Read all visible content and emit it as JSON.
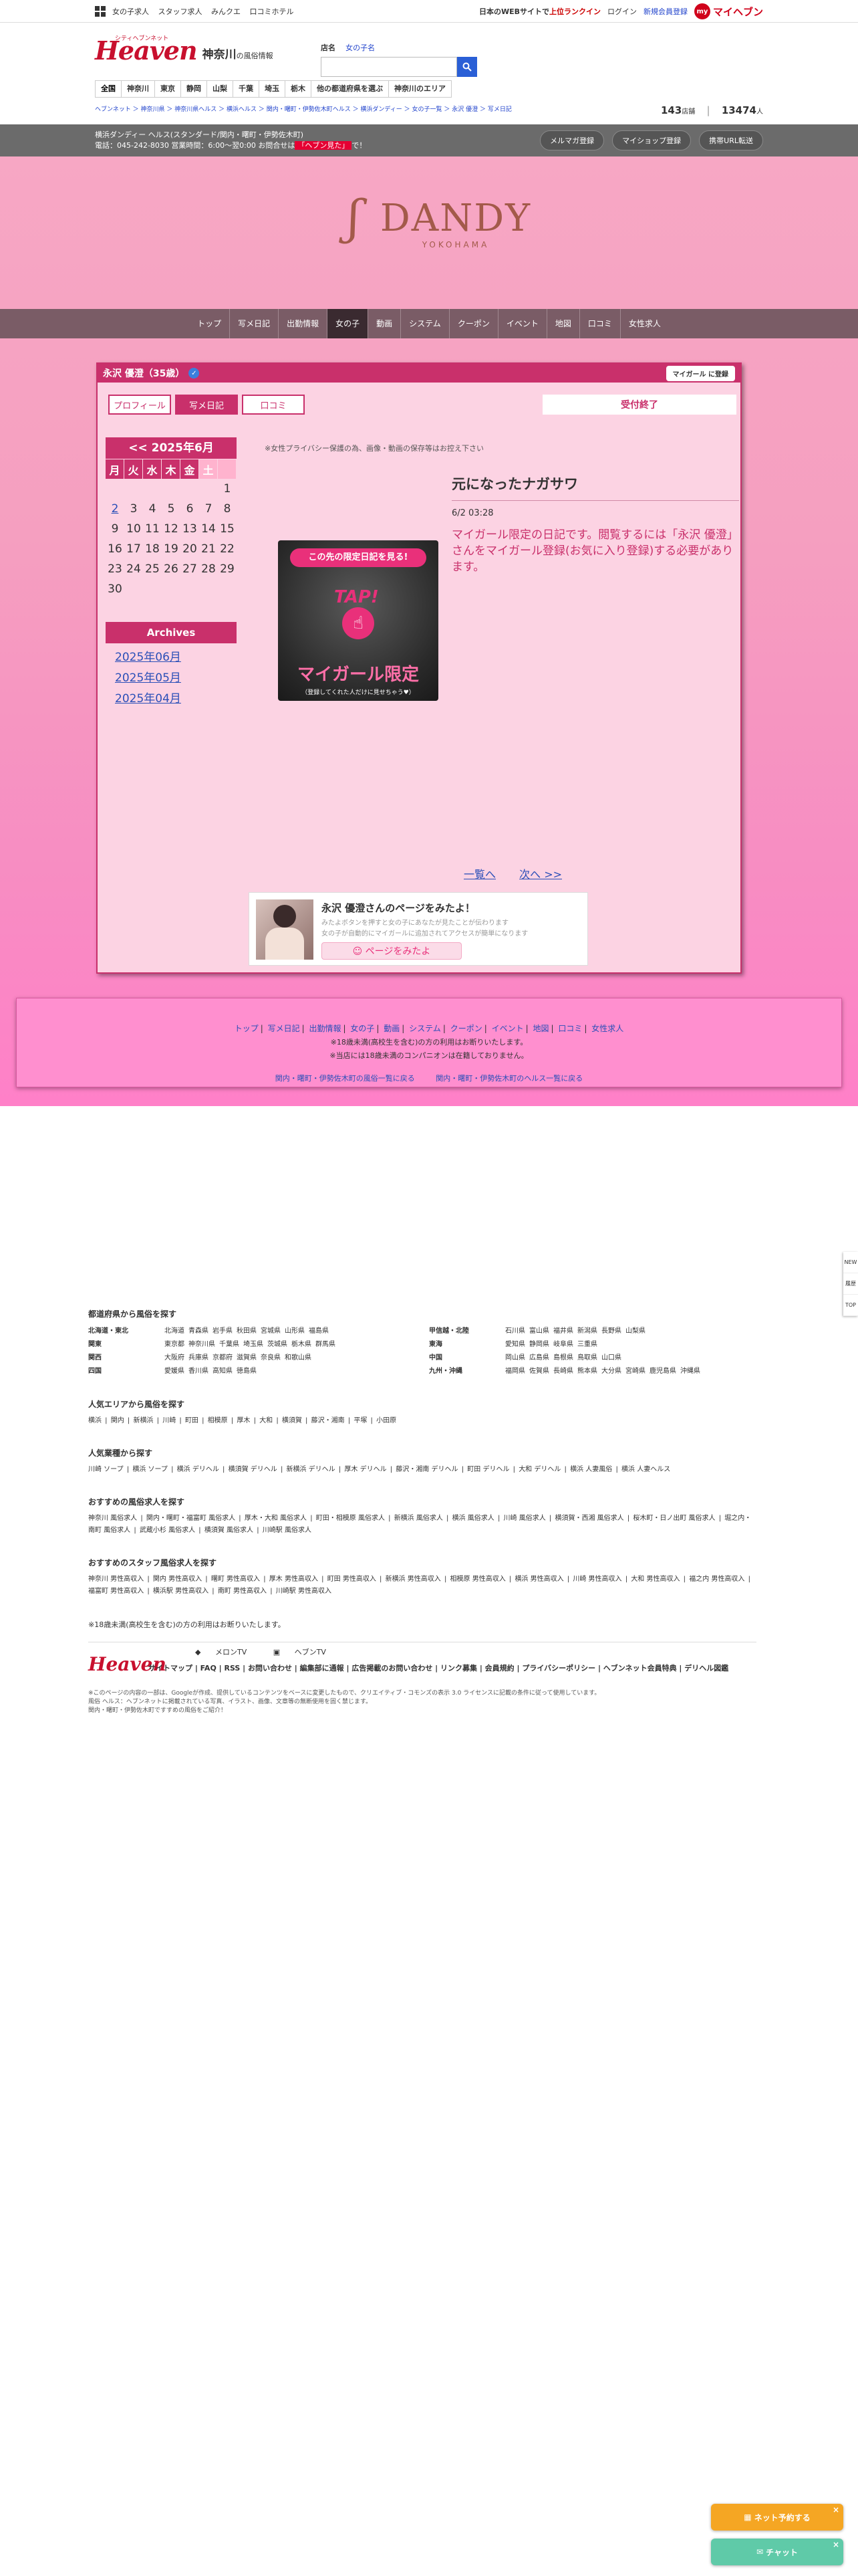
{
  "util": {
    "links": [
      "女の子求人",
      "スタッフ求人",
      "みんクエ",
      "口コミホテル"
    ],
    "notice_pre": "日本のWEBサイトで",
    "notice_hl": "上位ランクイン",
    "login": "ログイン",
    "register": "新規会員登録",
    "myheaven_badge": "my",
    "myheaven": "マイヘブン"
  },
  "header": {
    "logo": "Heaven",
    "logo_sub": "シティヘブンネット",
    "region": "神奈川",
    "region_suffix": "の風俗情報",
    "search_label": "店名",
    "search_mode": "女の子名",
    "search_placeholder": "",
    "shops_count": "143",
    "shops_unit": "店舗",
    "girls_count": "13474",
    "girls_unit": "人",
    "regions": [
      "全国",
      "神奈川",
      "東京",
      "静岡",
      "山梨",
      "千葉",
      "埼玉",
      "栃木",
      "他の都道府県を選ぶ",
      "神奈川のエリア"
    ],
    "breadcrumb": "ヘブンネット ＞ 神奈川県 ＞ 神奈川県ヘルス ＞ 横浜ヘルス ＞ 関内・曙町・伊勢佐木町ヘルス ＞ 横浜ダンディー ＞ 女の子一覧 ＞ 永沢 優澄 ＞ 写メ日記"
  },
  "shopbar": {
    "line1": "横浜ダンディー ヘルス(スタンダード/関内・曙町・伊勢佐木町)",
    "line2_pre": "電話：045-242-8030 営業時間：6:00〜翌0:00 お問合せは",
    "line2_warn": "「ヘブン見た」",
    "line2_post": "で！",
    "buttons": [
      "メルマガ登録",
      "マイショップ登録",
      "携帯URL転送"
    ]
  },
  "banner": {
    "mark": "ʃ",
    "name": "DANDY",
    "city": "YOKOHAMA"
  },
  "nav": [
    "トップ",
    "写メ日記",
    "出勤情報",
    "女の子",
    "動画",
    "システム",
    "クーポン",
    "イベント",
    "地図",
    "口コミ",
    "女性求人"
  ],
  "profile": {
    "title": "永沢 優澄（35歳）",
    "verified_mark": "✓",
    "mygirl_button": "マイガール に登録",
    "tabs": [
      "プロフィール",
      "写メ日記",
      "口コミ"
    ],
    "status": "受付終了"
  },
  "calendar": {
    "month_label": "<< 2025年6月",
    "dow": [
      "月",
      "火",
      "水",
      "木",
      "金",
      "土"
    ],
    "weeks": [
      [
        "",
        "",
        "",
        "",
        "",
        "1"
      ],
      [
        "2",
        "3",
        "4",
        "5",
        "6",
        "7",
        "8"
      ],
      [
        "9",
        "10",
        "11",
        "12",
        "13",
        "14",
        "15"
      ],
      [
        "16",
        "17",
        "18",
        "19",
        "20",
        "21",
        "22"
      ],
      [
        "23",
        "24",
        "25",
        "26",
        "27",
        "28",
        "29"
      ],
      [
        "30"
      ]
    ],
    "archives_label": "Archives",
    "archives": [
      "2025年06月",
      "2025年05月",
      "2025年04月"
    ]
  },
  "diary": {
    "privacy": "※女性プライバシー保護の為、画像・動画の保存等はお控え下さい",
    "title": "元になったナガサワ",
    "date": "6/2 03:28",
    "body": "マイガール限定の日記です。閲覧するには「永沢 優澄」さんをマイガール登録(お気に入り登録)する必要があります。",
    "teaser_top": "この先の限定日記を見る!",
    "teaser_tap": "TAP!",
    "teaser_main": "マイガール限定",
    "teaser_bottom": "（登録してくれた人だけに見せちゃう♥）",
    "pager_list": "一覧へ",
    "pager_next": "次へ >>"
  },
  "mypop": {
    "heading": "永沢 優澄さんのページをみたよ！",
    "line1": "みたよボタンを押すと女の子にあなたが見たことが伝わります",
    "line2": "女の子が自動的にマイガールに追加されてアクセスが簡単になります",
    "button": "☺ ページをみたよ"
  },
  "pinkfoot": {
    "links": [
      "トップ",
      "写メ日記",
      "出勤情報",
      "女の子",
      "動画",
      "システム",
      "クーポン",
      "イベント",
      "地図",
      "口コミ",
      "女性求人"
    ],
    "note1": "※18歳未満(高校生を含む)の方の利用はお断りいたします。",
    "note2": "※当店には18歳未満のコンパニオンは在籍しておりません。",
    "back1": "関内・曙町・伊勢佐木町の風俗一覧に戻る",
    "back2": "関内・曙町・伊勢佐木町のヘルス一覧に戻る"
  },
  "sitefoot": {
    "pref_title": "都道府県から風俗を探す",
    "pref_left": [
      {
        "k": "北海道・東北",
        "v": [
          "北海道",
          "青森県",
          "岩手県",
          "秋田県",
          "宮城県",
          "山形県",
          "福島県"
        ]
      },
      {
        "k": "関東",
        "v": [
          "東京都",
          "神奈川県",
          "千葉県",
          "埼玉県",
          "茨城県",
          "栃木県",
          "群馬県"
        ]
      },
      {
        "k": "関西",
        "v": [
          "大阪府",
          "兵庫県",
          "京都府",
          "滋賀県",
          "奈良県",
          "和歌山県"
        ]
      },
      {
        "k": "四国",
        "v": [
          "愛媛県",
          "香川県",
          "高知県",
          "徳島県"
        ]
      }
    ],
    "pref_right": [
      {
        "k": "甲信越・北陸",
        "v": [
          "石川県",
          "富山県",
          "福井県",
          "新潟県",
          "長野県",
          "山梨県"
        ]
      },
      {
        "k": "東海",
        "v": [
          "愛知県",
          "静岡県",
          "岐阜県",
          "三重県"
        ]
      },
      {
        "k": "中国",
        "v": [
          "岡山県",
          "広島県",
          "島根県",
          "鳥取県",
          "山口県"
        ]
      },
      {
        "k": "九州・沖縄",
        "v": [
          "福岡県",
          "佐賀県",
          "長崎県",
          "熊本県",
          "大分県",
          "宮崎県",
          "鹿児島県",
          "沖縄県"
        ]
      }
    ],
    "area_title": "人気エリアから風俗を探す",
    "areas": [
      "横浜",
      "関内",
      "新横浜",
      "川崎",
      "町田",
      "相模原",
      "厚木",
      "大和",
      "横須賀",
      "藤沢・湘南",
      "平塚",
      "小田原"
    ],
    "genre_title": "人気業種から探す",
    "genres": [
      "川崎 ソープ",
      "横浜 ソープ",
      "横浜 デリヘル",
      "横須賀 デリヘル",
      "新横浜 デリヘル",
      "厚木 デリヘル",
      "藤沢・湘南 デリヘル",
      "町田 デリヘル",
      "大和 デリヘル",
      "横浜 人妻風俗",
      "横浜 人妻ヘルス"
    ],
    "jobs_title": "おすすめの風俗求人を探す",
    "jobs": [
      "神奈川 風俗求人",
      "関内・曙町・福富町 風俗求人",
      "厚木・大和 風俗求人",
      "町田・相模原 風俗求人",
      "新横浜 風俗求人",
      "横浜 風俗求人",
      "川崎 風俗求人",
      "横須賀・西湘 風俗求人",
      "桜木町・日ノ出町 風俗求人",
      "堀之内・南町 風俗求人",
      "武蔵小杉 風俗求人",
      "横須賀 風俗求人",
      "川崎駅 風俗求人"
    ],
    "staff_title": "おすすめのスタッフ風俗求人を探す",
    "staff": [
      "神奈川 男性高収入",
      "関内 男性高収入",
      "曙町 男性高収入",
      "厚木 男性高収入",
      "町田 男性高収入",
      "新横浜 男性高収入",
      "相模原 男性高収入",
      "横浜 男性高収入",
      "川崎 男性高収入",
      "大和 男性高収入",
      "福之内 男性高収入",
      "福富町 男性高収入",
      "横浜駅 男性高収入",
      "南町 男性高収入",
      "川崎駅 男性高収入"
    ],
    "adult": "※18歳未満(高校生を含む)の方の利用はお断りいたします。",
    "tv": [
      "メロンTV",
      "ヘブンTV"
    ],
    "footer_links": "サイトマップ | FAQ | RSS | お問い合わせ | 編集部に通報 | 広告掲載のお問い合わせ | リンク募集 | 会員規約 | プライバシーポリシー | ヘブンネット会員特典 | デリヘル図鑑",
    "small1": "※このページの内容の一部は、Googleが作成、提供しているコンテンツをベースに変更したもので、クリエイティブ・コモンズの表示 3.0 ライセンスに記載の条件に従って使用しています。",
    "small2": "風俗 ヘルス：ヘブンネットに掲載されている写真、イラスト、画像、文章等の無断使用を固く禁じます。",
    "small3": "関内・曙町・伊勢佐木町ですすめの風俗をご紹介！"
  },
  "floating": {
    "side": [
      "NEW",
      "履歴",
      "TOP"
    ],
    "net_button": "ネット予約する",
    "chat_button": "チャット",
    "close": "×"
  }
}
